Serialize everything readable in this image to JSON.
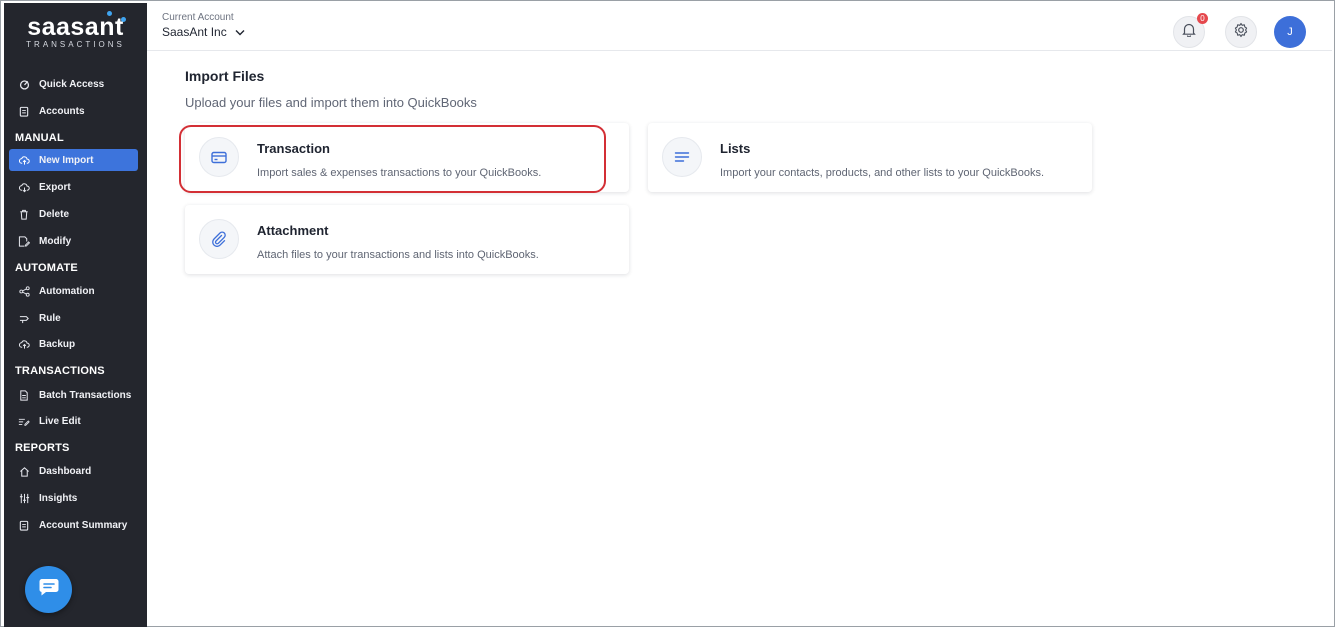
{
  "brand": {
    "logo_text": "saasant",
    "logo_sub": "TRANSACTIONS",
    "accent": "#3d74dc"
  },
  "sidebar": {
    "top_items": [
      {
        "label": "Quick Access",
        "icon": "quick-access-icon"
      },
      {
        "label": "Accounts",
        "icon": "accounts-icon"
      }
    ],
    "sections": [
      {
        "title": "MANUAL",
        "items": [
          {
            "label": "New Import",
            "icon": "upload-cloud-icon",
            "active": true
          },
          {
            "label": "Export",
            "icon": "download-cloud-icon"
          },
          {
            "label": "Delete",
            "icon": "trash-icon"
          },
          {
            "label": "Modify",
            "icon": "edit-file-icon"
          }
        ]
      },
      {
        "title": "AUTOMATE",
        "items": [
          {
            "label": "Automation",
            "icon": "automation-icon"
          },
          {
            "label": "Rule",
            "icon": "rule-icon"
          },
          {
            "label": "Backup",
            "icon": "backup-icon"
          }
        ]
      },
      {
        "title": "TRANSACTIONS",
        "items": [
          {
            "label": "Batch Transactions",
            "icon": "batch-icon"
          },
          {
            "label": "Live Edit",
            "icon": "live-edit-icon"
          }
        ]
      },
      {
        "title": "REPORTS",
        "items": [
          {
            "label": "Dashboard",
            "icon": "home-icon"
          },
          {
            "label": "Insights",
            "icon": "sliders-icon"
          },
          {
            "label": "Account Summary",
            "icon": "summary-icon"
          }
        ]
      }
    ]
  },
  "header": {
    "account_label": "Current Account",
    "account_value": "SaasAnt Inc",
    "notification_count": "0",
    "avatar_initial": "J"
  },
  "main": {
    "title": "Import Files",
    "subtitle": "Upload your files and import them into QuickBooks",
    "cards": [
      {
        "title": "Transaction",
        "description": "Import sales & expenses transactions to your QuickBooks.",
        "icon": "credit-card-icon"
      },
      {
        "title": "Lists",
        "description": "Import your contacts, products, and other lists to your QuickBooks.",
        "icon": "list-icon"
      },
      {
        "title": "Attachment",
        "description": "Attach files to your transactions and lists into QuickBooks.",
        "icon": "paperclip-icon"
      }
    ]
  }
}
